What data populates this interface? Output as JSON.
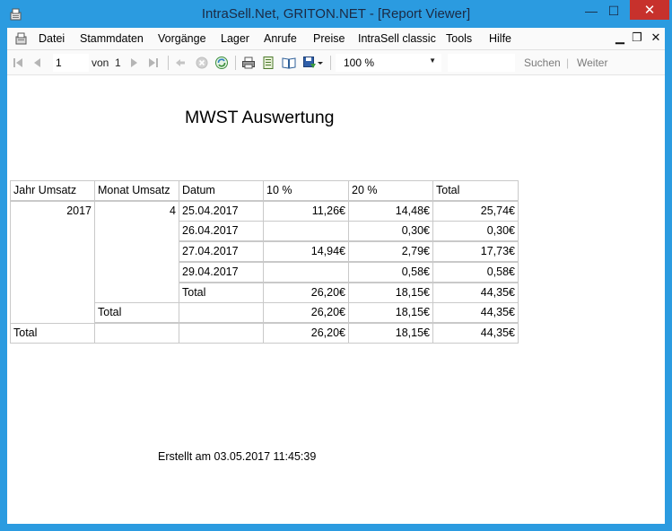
{
  "window": {
    "title": "IntraSell.Net, GRITON.NET - [Report Viewer]",
    "minimize_glyph": "—",
    "maximize_glyph": "☐",
    "close_glyph": "✕"
  },
  "menu": {
    "items": [
      "Datei",
      "Stammdaten",
      "Vorgänge",
      "Lager",
      "Anrufe",
      "Preise",
      "IntraSell classic",
      "Tools",
      "Hilfe"
    ],
    "mdi_minimize": "▁",
    "mdi_restore": "❐",
    "mdi_close": "✕"
  },
  "toolbar": {
    "current_page": "1",
    "of_label": "von",
    "total_pages": "1",
    "zoom": "100 %",
    "search_placeholder": "",
    "find_label": "Suchen",
    "next_label": "Weiter",
    "separator": "|"
  },
  "report": {
    "title": "MWST Auswertung",
    "headers": [
      "Jahr Umsatz",
      "Monat Umsatz",
      "Datum",
      "10 %",
      "20 %",
      "Total"
    ],
    "year": "2017",
    "month": "4",
    "rows": [
      {
        "date": "25.04.2017",
        "v10": "11,26€",
        "v20": "14,48€",
        "total": "25,74€"
      },
      {
        "date": "26.04.2017",
        "v10": "",
        "v20": "0,30€",
        "total": "0,30€"
      },
      {
        "date": "27.04.2017",
        "v10": "14,94€",
        "v20": "2,79€",
        "total": "17,73€"
      },
      {
        "date": "29.04.2017",
        "v10": "",
        "v20": "0,58€",
        "total": "0,58€"
      }
    ],
    "month_total": {
      "label": "Total",
      "v10": "26,20€",
      "v20": "18,15€",
      "total": "44,35€"
    },
    "year_total": {
      "label": "Total",
      "v10": "26,20€",
      "v20": "18,15€",
      "total": "44,35€"
    },
    "grand_total": {
      "label": "Total",
      "v10": "26,20€",
      "v20": "18,15€",
      "total": "44,35€"
    },
    "footer": "Erstellt am 03.05.2017 11:45:39"
  }
}
